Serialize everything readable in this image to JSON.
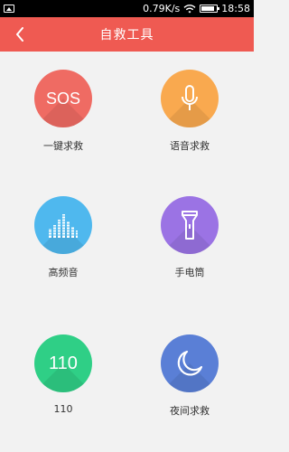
{
  "status_bar": {
    "speed": "0.79K/s",
    "time": "18:58"
  },
  "header": {
    "title": "自救工具"
  },
  "tools": [
    {
      "label": "一键求救",
      "icon": "sos-icon",
      "icon_text": "SOS",
      "color": "#ef6b63"
    },
    {
      "label": "语音求救",
      "icon": "microphone-icon",
      "color": "#f9a94f"
    },
    {
      "label": "高频音",
      "icon": "sound-bars-icon",
      "color": "#4fb8ee"
    },
    {
      "label": "手电筒",
      "icon": "flashlight-icon",
      "color": "#9b73e4"
    },
    {
      "label": "110",
      "icon": "110-icon",
      "icon_text": "110",
      "color": "#2fcf86"
    },
    {
      "label": "夜间求救",
      "icon": "moon-icon",
      "color": "#5a7fd6"
    }
  ]
}
